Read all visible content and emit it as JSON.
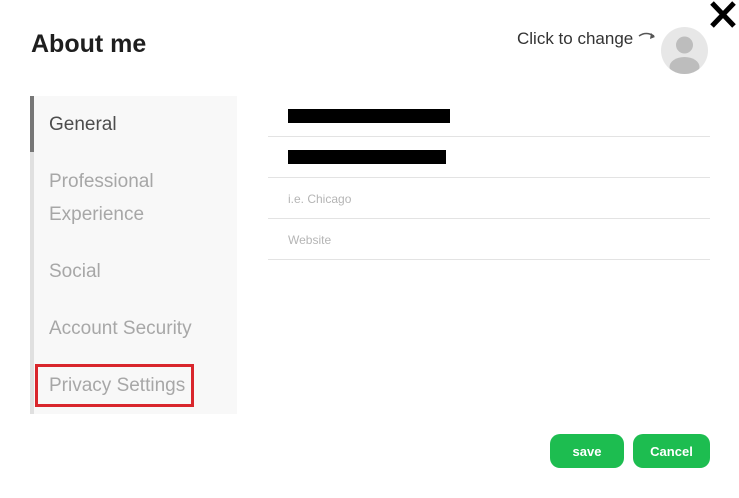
{
  "dialog": {
    "title": "About me",
    "avatar_hint": "Click to change"
  },
  "sidebar": {
    "items": [
      {
        "label": "General"
      },
      {
        "label": "Professional"
      },
      {
        "label": "Experience"
      },
      {
        "label": "Social"
      },
      {
        "label": "Account Security"
      },
      {
        "label": "Privacy Settings"
      }
    ]
  },
  "form": {
    "city_placeholder": "i.e. Chicago",
    "website_placeholder": "Website"
  },
  "actions": {
    "save_label": "save",
    "cancel_label": "Cancel"
  },
  "colors": {
    "accent_green": "#1dbd50",
    "highlight_red": "#d9262c"
  }
}
